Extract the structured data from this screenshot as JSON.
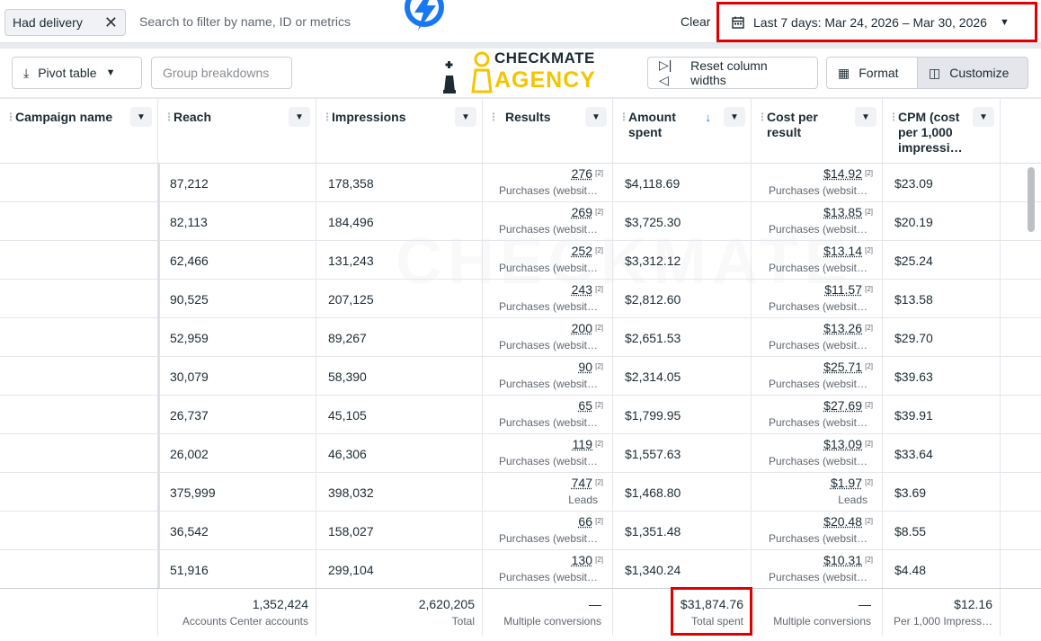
{
  "filter": {
    "chip_label": "Had delivery",
    "search_placeholder": "Search to filter by name, ID or metrics",
    "clear_label": "Clear",
    "date_range": "Last 7 days: Mar 24, 2026 – Mar 30, 2026"
  },
  "toolbar": {
    "pivot_label": "Pivot table",
    "group_label": "Group breakdowns",
    "reset_label": "Reset column widths",
    "format_label": "Format",
    "customize_label": "Customize"
  },
  "brand": {
    "line1": "CHECKMATE",
    "line2": "AGENCY"
  },
  "columns": {
    "campaign": "Campaign name",
    "reach": "Reach",
    "impressions": "Impressions",
    "results": "Results",
    "amount": "Amount spent",
    "cpr": "Cost per result",
    "cpm": "CPM (cost per 1,000 impressi…"
  },
  "rows": [
    {
      "reach": "87,212",
      "impressions": "178,358",
      "results": "276",
      "results_sub": "Purchases (websit…",
      "amount": "$4,118.69",
      "cpr": "$14.92",
      "cpr_sub": "Purchases (websit…",
      "cpm": "$23.09"
    },
    {
      "reach": "82,113",
      "impressions": "184,496",
      "results": "269",
      "results_sub": "Purchases (websit…",
      "amount": "$3,725.30",
      "cpr": "$13.85",
      "cpr_sub": "Purchases (websit…",
      "cpm": "$20.19"
    },
    {
      "reach": "62,466",
      "impressions": "131,243",
      "results": "252",
      "results_sub": "Purchases (websit…",
      "amount": "$3,312.12",
      "cpr": "$13.14",
      "cpr_sub": "Purchases (websit…",
      "cpm": "$25.24"
    },
    {
      "reach": "90,525",
      "impressions": "207,125",
      "results": "243",
      "results_sub": "Purchases (websit…",
      "amount": "$2,812.60",
      "cpr": "$11.57",
      "cpr_sub": "Purchases (websit…",
      "cpm": "$13.58"
    },
    {
      "reach": "52,959",
      "impressions": "89,267",
      "results": "200",
      "results_sub": "Purchases (websit…",
      "amount": "$2,651.53",
      "cpr": "$13.26",
      "cpr_sub": "Purchases (websit…",
      "cpm": "$29.70"
    },
    {
      "reach": "30,079",
      "impressions": "58,390",
      "results": "90",
      "results_sub": "Purchases (websit…",
      "amount": "$2,314.05",
      "cpr": "$25.71",
      "cpr_sub": "Purchases (websit…",
      "cpm": "$39.63"
    },
    {
      "reach": "26,737",
      "impressions": "45,105",
      "results": "65",
      "results_sub": "Purchases (websit…",
      "amount": "$1,799.95",
      "cpr": "$27.69",
      "cpr_sub": "Purchases (websit…",
      "cpm": "$39.91"
    },
    {
      "reach": "26,002",
      "impressions": "46,306",
      "results": "119",
      "results_sub": "Purchases (websit…",
      "amount": "$1,557.63",
      "cpr": "$13.09",
      "cpr_sub": "Purchases (websit…",
      "cpm": "$33.64"
    },
    {
      "reach": "375,999",
      "impressions": "398,032",
      "results": "747",
      "results_sub": "Leads",
      "amount": "$1,468.80",
      "cpr": "$1.97",
      "cpr_sub": "Leads",
      "cpm": "$3.69"
    },
    {
      "reach": "36,542",
      "impressions": "158,027",
      "results": "66",
      "results_sub": "Purchases (websit…",
      "amount": "$1,351.48",
      "cpr": "$20.48",
      "cpr_sub": "Purchases (websit…",
      "cpm": "$8.55"
    },
    {
      "reach": "51,916",
      "impressions": "299,104",
      "results": "130",
      "results_sub": "Purchases (websit…",
      "amount": "$1,340.24",
      "cpr": "$10.31",
      "cpr_sub": "Purchases (websit…",
      "cpm": "$4.48"
    }
  ],
  "superscript": "[2]",
  "footer": {
    "reach": "1,352,424",
    "reach_label": "Accounts Center accounts",
    "impressions": "2,620,205",
    "impressions_label": "Total",
    "results": "—",
    "results_label": "Multiple conversions",
    "amount": "$31,874.76",
    "amount_label": "Total spent",
    "cpr": "—",
    "cpr_label": "Multiple conversions",
    "cpm": "$12.16",
    "cpm_label": "Per 1,000 Impress…"
  },
  "watermark": "CHECKMATE",
  "colors": {
    "highlight": "#e00000",
    "brand_yellow": "#f5c400",
    "bolt_blue": "#1877f2"
  }
}
